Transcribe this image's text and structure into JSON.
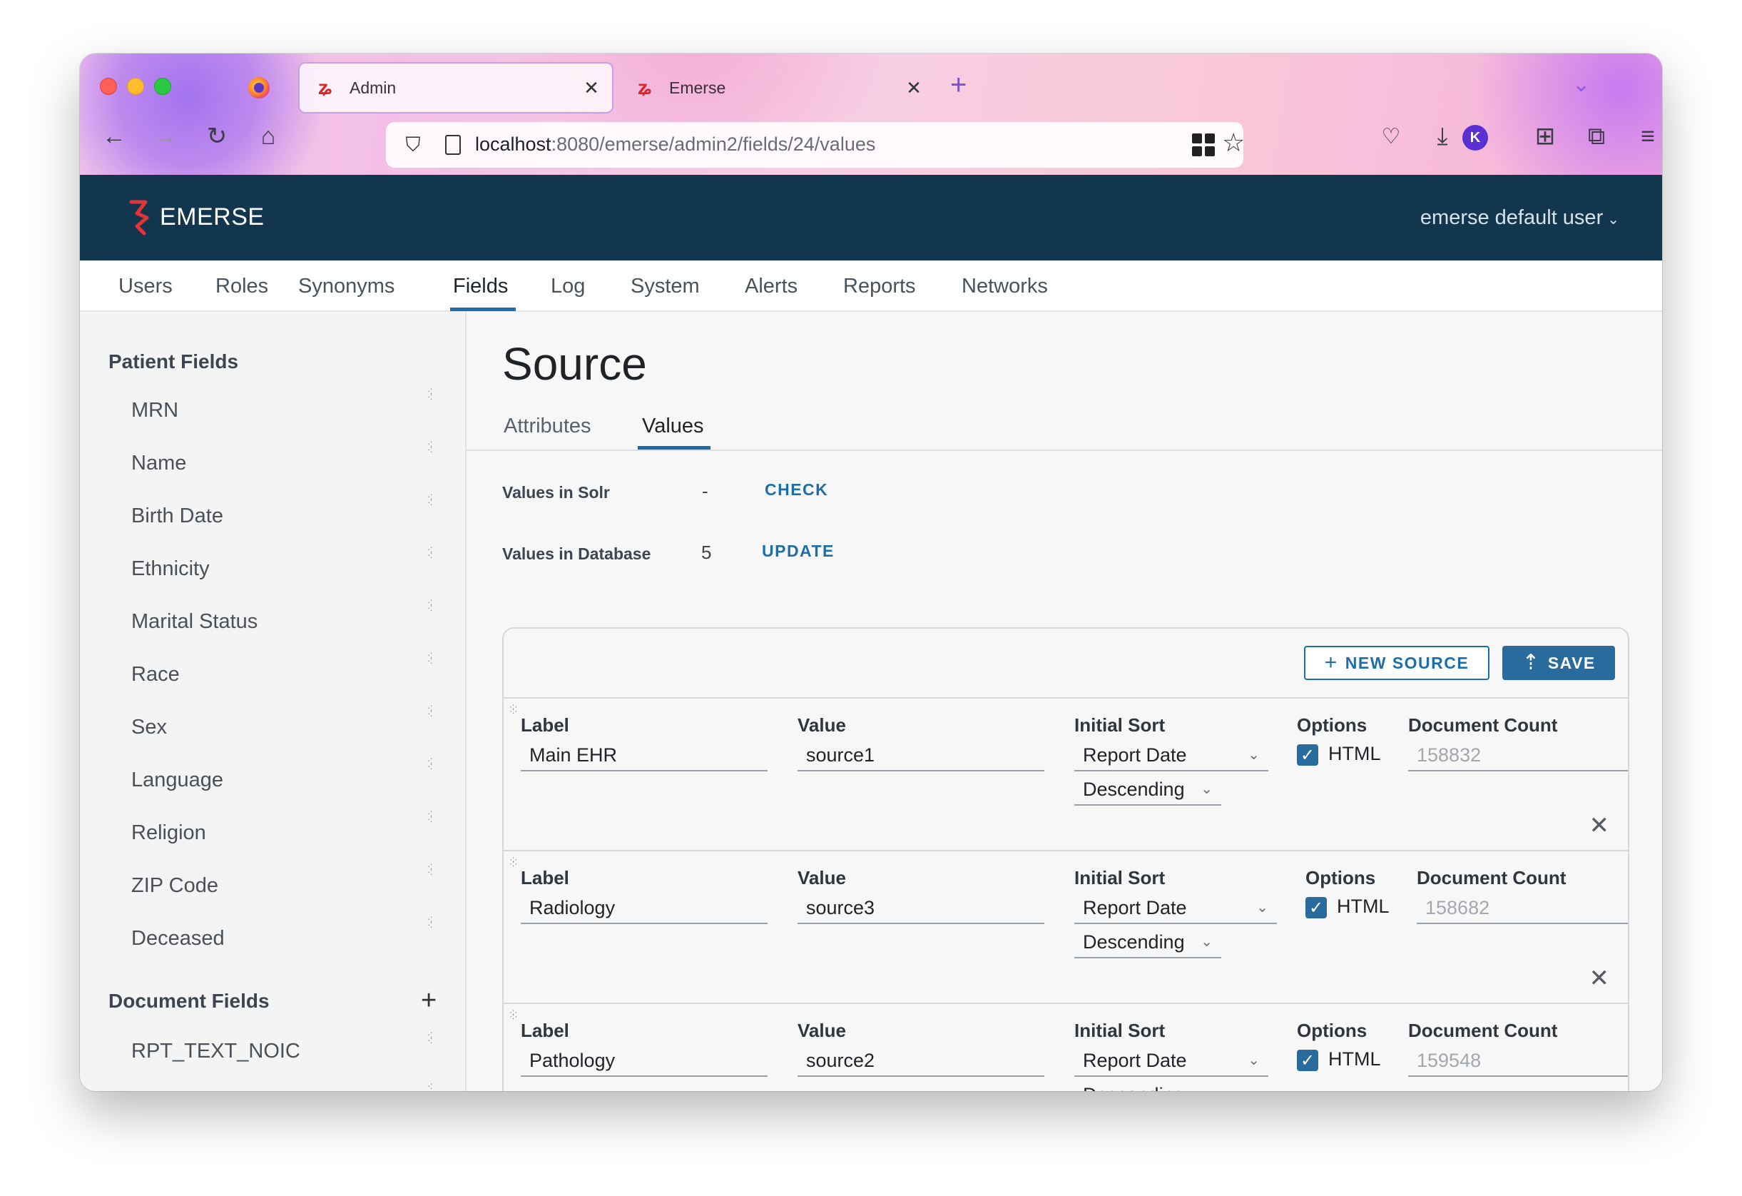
{
  "browser": {
    "tabs": [
      {
        "title": "Admin",
        "active": true
      },
      {
        "title": "Emerse",
        "active": false
      }
    ],
    "url_host": "localhost",
    "url_path": ":8080/emerse/admin2/fields/24/values",
    "avatar_letter": "K"
  },
  "app": {
    "name": "EMERSE",
    "user_menu": "emerse default user",
    "brand_color": "#12364e",
    "accent_color": "#1d6ea8"
  },
  "nav": {
    "items": [
      "Users",
      "Roles",
      "Synonyms",
      "Fields",
      "Log",
      "System",
      "Alerts",
      "Reports",
      "Networks"
    ],
    "active": "Fields"
  },
  "sidebar": {
    "patient_heading": "Patient Fields",
    "patient_fields": [
      "MRN",
      "Name",
      "Birth Date",
      "Ethnicity",
      "Marital Status",
      "Race",
      "Sex",
      "Language",
      "Religion",
      "ZIP Code",
      "Deceased"
    ],
    "document_heading": "Document Fields",
    "document_fields": [
      "RPT_TEXT_NOIC"
    ]
  },
  "main": {
    "title": "Source",
    "tabs": [
      "Attributes",
      "Values"
    ],
    "active_tab": "Values",
    "values_in_solr_label": "Values in Solr",
    "values_in_solr_value": "-",
    "check_label": "CHECK",
    "values_in_db_label": "Values in Database",
    "values_in_db_value": "5",
    "update_label": "UPDATE",
    "new_source_label": "NEW SOURCE",
    "save_label": "SAVE",
    "column_labels": {
      "label": "Label",
      "value": "Value",
      "initial_sort": "Initial Sort",
      "options": "Options",
      "document_count": "Document Count"
    },
    "rows": [
      {
        "label": "Main EHR",
        "value": "source1",
        "sort_field": "Report Date",
        "sort_dir": "Descending",
        "option": "HTML",
        "html_checked": true,
        "doc_count": "158832"
      },
      {
        "label": "Radiology",
        "value": "source3",
        "sort_field": "Report Date",
        "sort_dir": "Descending",
        "option": "HTML",
        "html_checked": true,
        "doc_count": "158682"
      },
      {
        "label": "Pathology",
        "value": "source2",
        "sort_field": "Report Date",
        "sort_dir": "Descending",
        "option": "HTML",
        "html_checked": true,
        "doc_count": "159548"
      }
    ]
  }
}
